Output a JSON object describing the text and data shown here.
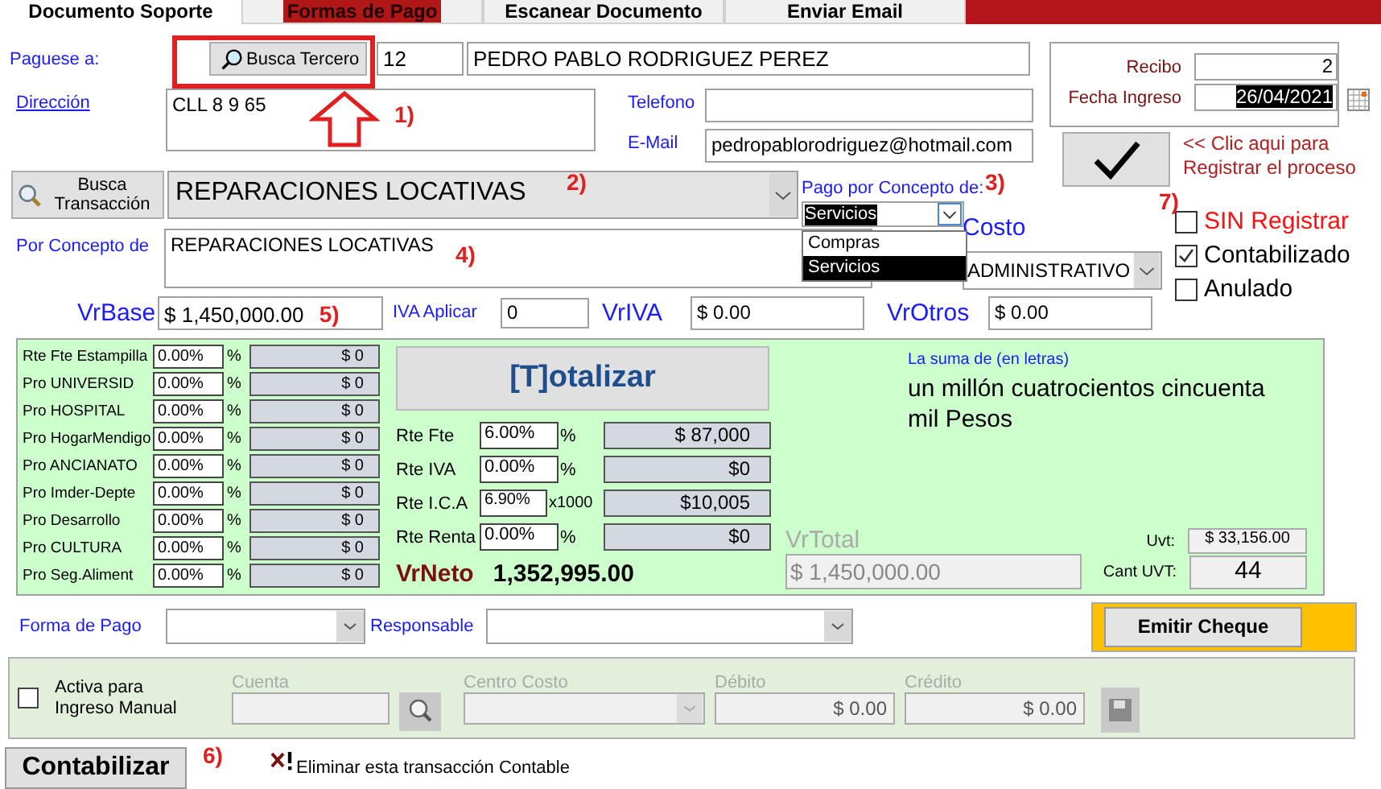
{
  "tabs": [
    {
      "label": "Documento Soporte",
      "selected": true,
      "highlighted": false
    },
    {
      "label": "Formas de Pago",
      "selected": false,
      "highlighted": true
    },
    {
      "label": "Escanear Documento",
      "selected": false,
      "highlighted": false
    },
    {
      "label": "Enviar Email",
      "selected": false,
      "highlighted": false
    }
  ],
  "payee": {
    "label": "Paguese a:",
    "search_button": "Busca Tercero",
    "id": "12",
    "name": "PEDRO PABLO RODRIGUEZ PEREZ"
  },
  "address": {
    "label": "Dirección",
    "value": "CLL 8 9 65"
  },
  "phone": {
    "label": "Telefono"
  },
  "email": {
    "label": "E-Mail",
    "value": "pedropablorodriguez@hotmail.com"
  },
  "receipt": {
    "label": "Recibo",
    "value": "2"
  },
  "entry_date": {
    "label": "Fecha Ingreso",
    "value": "26/04/2021"
  },
  "register_hint": "<< Clic aqui para Registrar el proceso",
  "transaction": {
    "search_button": "Busca Transacción",
    "value": "REPARACIONES LOCATIVAS"
  },
  "payment_concept": {
    "label": "Pago por Concepto de:",
    "value": "Servicios",
    "options": [
      {
        "label": "Compras",
        "selected": false
      },
      {
        "label": "Servicios",
        "selected": true
      }
    ]
  },
  "cost_center": {
    "label": "Costo",
    "value": "ADMINISTRATIVO"
  },
  "status_checks": [
    {
      "label": "SIN Registrar",
      "checked": false,
      "kind": "alert"
    },
    {
      "label": "Contabilizado",
      "checked": true,
      "kind": "normal"
    },
    {
      "label": "Anulado",
      "checked": false,
      "kind": "normal"
    }
  ],
  "concept": {
    "label": "Por Concepto de",
    "value": "REPARACIONES LOCATIVAS"
  },
  "base": {
    "label": "VrBase",
    "value": "$ 1,450,000.00"
  },
  "iva_rate": {
    "label": "IVA Aplicar",
    "value": "0"
  },
  "iva": {
    "label": "VrIVA",
    "value": "$ 0.00"
  },
  "others": {
    "label": "VrOtros",
    "value": "$ 0.00"
  },
  "contributions": [
    {
      "label": "Rte Fte Estampilla",
      "percent": "0.00%",
      "unit": "%",
      "amount": "$ 0"
    },
    {
      "label": "Pro UNIVERSID",
      "percent": "0.00%",
      "unit": "%",
      "amount": "$ 0"
    },
    {
      "label": "Pro HOSPITAL",
      "percent": "0.00%",
      "unit": "%",
      "amount": "$ 0"
    },
    {
      "label": "Pro HogarMendigo",
      "percent": "0.00%",
      "unit": "%",
      "amount": "$ 0"
    },
    {
      "label": "Pro ANCIANATO",
      "percent": "0.00%",
      "unit": "%",
      "amount": "$ 0"
    },
    {
      "label": "Pro Imder-Depte",
      "percent": "0.00%",
      "unit": "%",
      "amount": "$ 0"
    },
    {
      "label": "Pro Desarrollo",
      "percent": "0.00%",
      "unit": "%",
      "amount": "$ 0"
    },
    {
      "label": "Pro CULTURA",
      "percent": "0.00%",
      "unit": "%",
      "amount": "$ 0"
    },
    {
      "label": "Pro Seg.Aliment",
      "percent": "0.00%",
      "unit": "%",
      "amount": "$ 0"
    }
  ],
  "totalize_button": "[T]otalizar",
  "withholdings": [
    {
      "label": "Rte Fte",
      "percent": "6.00%",
      "unit": "%",
      "amount": "$ 87,000"
    },
    {
      "label": "Rte IVA",
      "percent": "0.00%",
      "unit": "%",
      "amount": "$0"
    },
    {
      "label": "Rte I.C.A",
      "percent": "6.90%",
      "unit": "x1000",
      "amount": "$10,005"
    },
    {
      "label": "Rte Renta",
      "percent": "0.00%",
      "unit": "%",
      "amount": "$0"
    }
  ],
  "net": {
    "label": "VrNeto",
    "value": "1,352,995.00"
  },
  "in_words": {
    "label": "La suma de (en letras)",
    "value": "un millón cuatrocientos cincuenta mil Pesos"
  },
  "total": {
    "label": "VrTotal",
    "value": "$ 1,450,000.00",
    "disabled": true
  },
  "uvt": {
    "label": "Uvt:",
    "value": "$ 33,156.00"
  },
  "uvt_count": {
    "label": "Cant UVT:",
    "value": "44"
  },
  "payment_method": {
    "label": "Forma de Pago"
  },
  "responsible": {
    "label": "Responsable"
  },
  "emit_check_button": "Emitir Cheque",
  "manual_entry": {
    "label": "Activa para Ingreso Manual",
    "checked": false,
    "account_label": "Cuenta",
    "cost_center_label": "Centro Costo",
    "debit_label": "Débito",
    "debit": "$ 0.00",
    "credit_label": "Crédito",
    "credit": "$ 0.00"
  },
  "post_button": "Contabilizar",
  "delete_link": "Eliminar esta transacción Contable",
  "annotations": [
    "1)",
    "2)",
    "3)",
    "4)",
    "5)",
    "6)",
    "7)"
  ]
}
